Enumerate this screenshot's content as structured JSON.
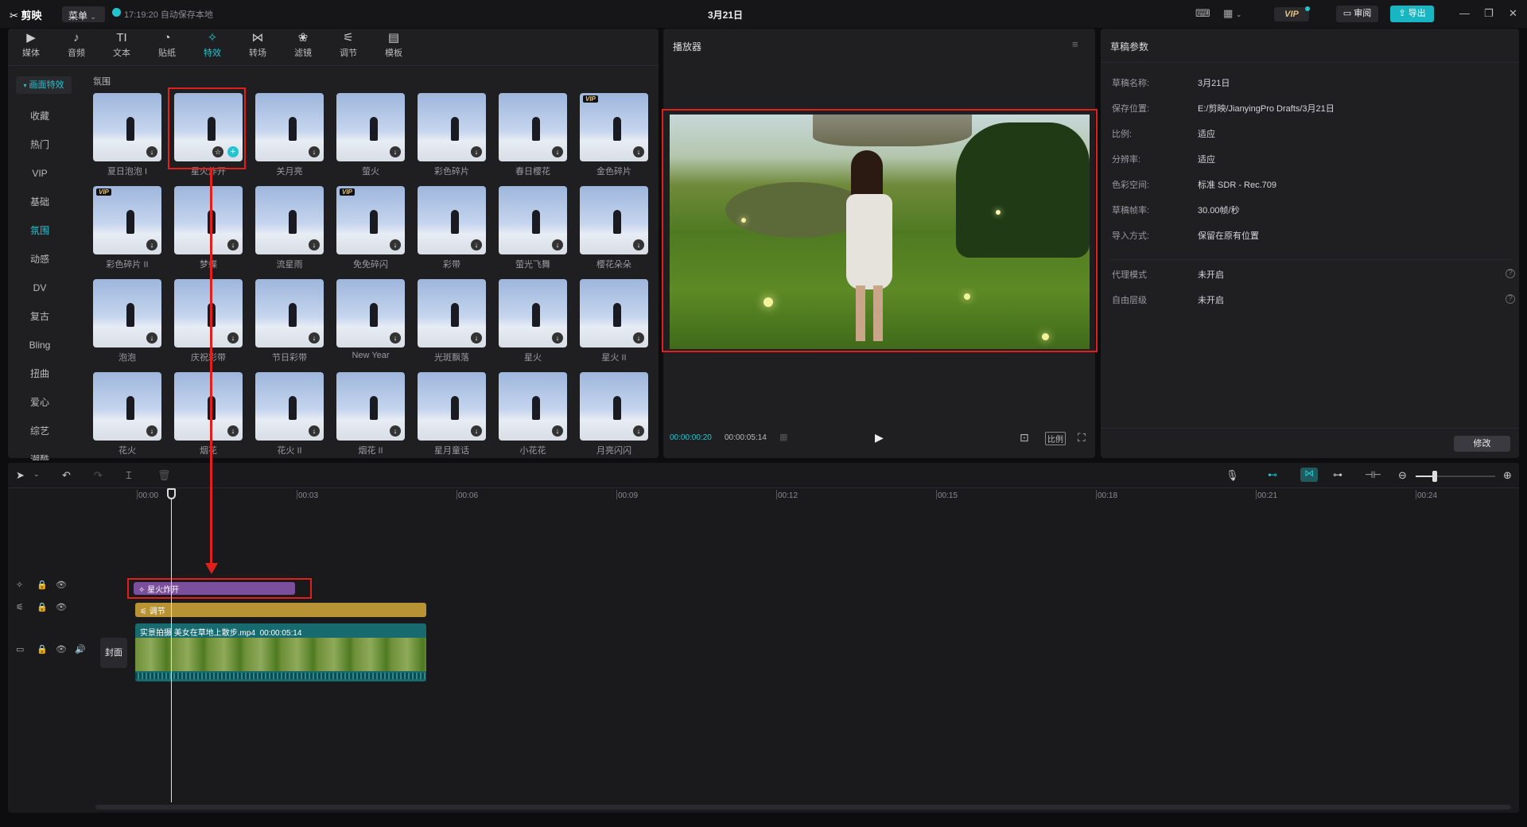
{
  "app": {
    "name": "剪映",
    "menu_label": "菜单",
    "save_status": "17:19:20 自动保存本地",
    "document_title": "3月21日",
    "vip_label": "VIP",
    "review_label": "审阅",
    "export_label": "导出"
  },
  "toolbar": {
    "tabs": [
      {
        "label": "媒体",
        "icon": "media-icon"
      },
      {
        "label": "音频",
        "icon": "audio-icon"
      },
      {
        "label": "文本",
        "icon": "text-icon"
      },
      {
        "label": "贴纸",
        "icon": "sticker-icon"
      },
      {
        "label": "特效",
        "icon": "effects-icon",
        "active": true
      },
      {
        "label": "转场",
        "icon": "transition-icon"
      },
      {
        "label": "滤镜",
        "icon": "filter-icon"
      },
      {
        "label": "调节",
        "icon": "adjust-icon"
      },
      {
        "label": "模板",
        "icon": "template-icon"
      }
    ]
  },
  "sidebar": {
    "section": "画面特效",
    "items": [
      "收藏",
      "热门",
      "VIP",
      "基础",
      "氛围",
      "动感",
      "DV",
      "复古",
      "Bling",
      "扭曲",
      "爱心",
      "综艺",
      "潮酷"
    ],
    "active": "氛围"
  },
  "effects": {
    "group_title": "氛围",
    "items": [
      {
        "label": "夏日泡泡 I",
        "vip": false
      },
      {
        "label": "星火炸开",
        "vip": false,
        "selected": true
      },
      {
        "label": "关月亮",
        "vip": false
      },
      {
        "label": "萤火",
        "vip": false
      },
      {
        "label": "彩色碎片",
        "vip": false
      },
      {
        "label": "春日樱花",
        "vip": false
      },
      {
        "label": "金色碎片",
        "vip": true
      },
      {
        "label": "彩色碎片 II",
        "vip": true
      },
      {
        "label": "梦蝶",
        "vip": false
      },
      {
        "label": "流星雨",
        "vip": false
      },
      {
        "label": "免免碎闪",
        "vip": true
      },
      {
        "label": "彩带",
        "vip": false
      },
      {
        "label": "萤光飞舞",
        "vip": false
      },
      {
        "label": "樱花朵朵",
        "vip": false
      },
      {
        "label": "泡泡",
        "vip": false
      },
      {
        "label": "庆祝彩带",
        "vip": false
      },
      {
        "label": "节日彩带",
        "vip": false
      },
      {
        "label": "New Year",
        "vip": false
      },
      {
        "label": "光斑飘落",
        "vip": false
      },
      {
        "label": "星火",
        "vip": false
      },
      {
        "label": "星火 II",
        "vip": false
      },
      {
        "label": "花火",
        "vip": false
      },
      {
        "label": "烟花",
        "vip": false
      },
      {
        "label": "花火 II",
        "vip": false
      },
      {
        "label": "烟花 II",
        "vip": false
      },
      {
        "label": "星月童话",
        "vip": false
      },
      {
        "label": "小花花",
        "vip": false
      },
      {
        "label": "月亮闪闪",
        "vip": false
      }
    ],
    "vip_tag": "VIP"
  },
  "player": {
    "title": "播放器",
    "current_time": "00:00:00:20",
    "total_time": "00:00:05:14",
    "ratio_label": "比例"
  },
  "draft": {
    "title": "草稿参数",
    "params": [
      {
        "k": "草稿名称:",
        "v": "3月21日"
      },
      {
        "k": "保存位置:",
        "v": "E:/剪映/JianyingPro Drafts/3月21日"
      },
      {
        "k": "比例:",
        "v": "适应"
      },
      {
        "k": "分辨率:",
        "v": "适应"
      },
      {
        "k": "色彩空间:",
        "v": "标准 SDR - Rec.709"
      },
      {
        "k": "草稿帧率:",
        "v": "30.00帧/秒"
      },
      {
        "k": "导入方式:",
        "v": "保留在原有位置"
      }
    ],
    "extra": [
      {
        "k": "代理模式",
        "v": "未开启"
      },
      {
        "k": "自由层级",
        "v": "未开启"
      }
    ],
    "modify_label": "修改"
  },
  "timeline": {
    "ticks": [
      "00:00",
      "00:03",
      "00:06",
      "00:09",
      "00:12",
      "00:15",
      "00:18",
      "00:21",
      "00:24"
    ],
    "effect_clip": "星火炸开",
    "adjust_clip": "调节",
    "video_clip_name": "实景拍摄 美女在草地上散步.mp4",
    "video_clip_duration": "00:00:05:14",
    "cover_label": "封面"
  },
  "colors": {
    "accent": "#22c4cf",
    "highlight_red": "#e0201c",
    "effect_clip": "#7b4f9c",
    "adjust_clip": "#b89335",
    "video_clip": "#176a6e"
  }
}
